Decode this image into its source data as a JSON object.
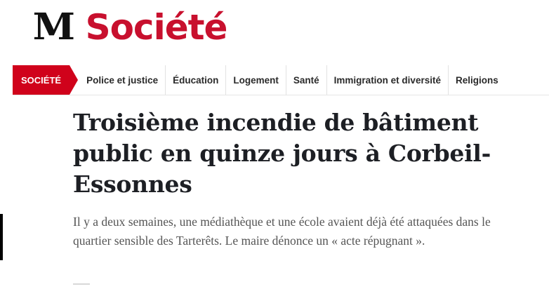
{
  "masthead": {
    "logo": "M",
    "section": "Société"
  },
  "nav": {
    "active": "SOCIÉTÉ",
    "items": [
      {
        "label": "Police et justice"
      },
      {
        "label": "Éducation"
      },
      {
        "label": "Logement"
      },
      {
        "label": "Santé"
      },
      {
        "label": "Immigration et diversité"
      },
      {
        "label": "Religions"
      }
    ]
  },
  "article": {
    "headline": "Troisième incendie de bâtiment public en quinze jours à Corbeil-Essonnes",
    "summary": "Il y a deux semaines, une médiathèque et une école avaient déjà été attaquées dans le quartier sensible des Tarterêts. Le maire dénonce un « acte répugnant »."
  },
  "colors": {
    "brand_red": "#c8102e",
    "nav_active_bg": "#d0021b",
    "headline": "#1d1f24",
    "summary": "#555555"
  }
}
